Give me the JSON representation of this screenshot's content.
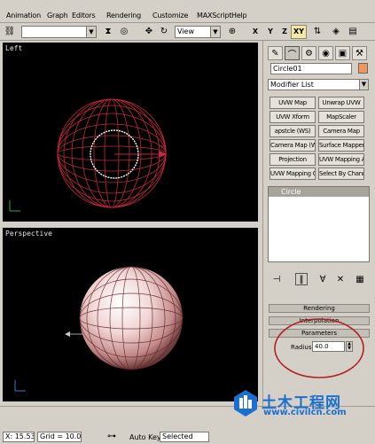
{
  "menu": [
    "Animation",
    "Graph",
    "Editors",
    "Rendering",
    "Customize",
    "MAXScript",
    "Help"
  ],
  "toolbar": {
    "selection_filter": "",
    "ref_coord": "View",
    "axis_x": "X",
    "axis_y": "Y",
    "axis_z": "Z",
    "axis_xy": "XY"
  },
  "viewports": {
    "top_label": "Left",
    "bottom_label": "Perspective"
  },
  "panel": {
    "object_name": "Circle01",
    "object_color": "#f0985c",
    "modifier_list": "Modifier List",
    "modifier_buttons": [
      "UVW Map",
      "Unwrap UVW",
      "UVW Xform",
      "MapScaler",
      "apstcle (WS)",
      "Camera Map",
      "Camera Map (WSM)",
      "Surface Mapper (WSM)",
      "Projection",
      "UVW Mapping Add",
      "UVW Mapping Clear",
      "Select By Channel"
    ],
    "stack_item": "Circle",
    "rollouts": [
      "Rendering",
      "Interpolation",
      "Parameters"
    ],
    "radius_label": "Radius:",
    "radius_value": "40.0"
  },
  "status": {
    "coord": "X: 15.53",
    "grid": "Grid = 10.0",
    "autokey": "Auto Key",
    "selected": "Selected"
  },
  "watermark": {
    "title": "土木工程网",
    "url": "www.civilcn.com"
  }
}
